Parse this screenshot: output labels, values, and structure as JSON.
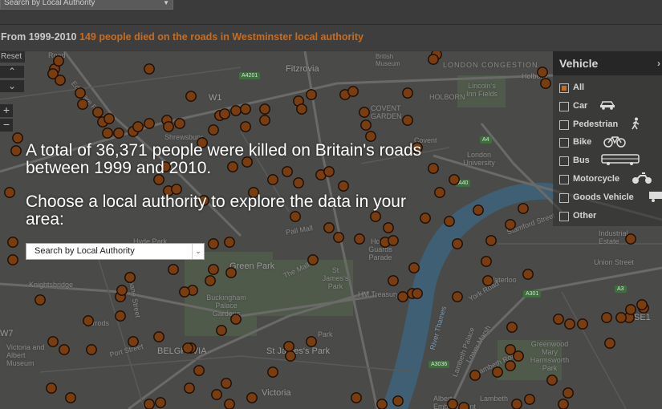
{
  "top_select": {
    "label": "Search by Local Authority"
  },
  "status": {
    "lead": "From 1999-2010",
    "highlight": "149 people died on the roads in Westminster local authority"
  },
  "controls": {
    "reset_label": "Reset",
    "zoom_in": "+",
    "zoom_out": "−"
  },
  "overlay": {
    "headline": "A total of 36,371 people were killed on Britain's roads between 1999 and 2010.",
    "subhead": "Choose a local authority to explore the data in your area:",
    "select_label": "Search by Local Authority"
  },
  "legend": {
    "title": "Vehicle",
    "items": [
      {
        "label": "All",
        "checked": true,
        "icon": "none"
      },
      {
        "label": "Car",
        "checked": false,
        "icon": "car-icon"
      },
      {
        "label": "Pedestrian",
        "checked": false,
        "icon": "pedestrian-icon"
      },
      {
        "label": "Bike",
        "checked": false,
        "icon": "bike-icon"
      },
      {
        "label": "Bus",
        "checked": false,
        "icon": "bus-icon"
      },
      {
        "label": "Motorcycle",
        "checked": false,
        "icon": "motorcycle-icon"
      },
      {
        "label": "Goods Vehicle",
        "checked": false,
        "icon": "truck-icon"
      },
      {
        "label": "Other",
        "checked": false,
        "icon": "none"
      }
    ]
  },
  "map_labels": [
    {
      "text": "Fitzrovia",
      "big": true
    },
    {
      "text": "British Museum",
      "big": false
    },
    {
      "text": "LONDON CONGESTION",
      "big": false
    },
    {
      "text": "HOLBORN",
      "big": false
    },
    {
      "text": "Lincoln's Inn Fields",
      "big": false
    },
    {
      "text": "COVENT GARDEN",
      "big": false
    },
    {
      "text": "W1",
      "big": true
    },
    {
      "text": "Shrewsbury",
      "big": false
    },
    {
      "text": "London University",
      "big": false
    },
    {
      "text": "Stamford Street",
      "big": false
    },
    {
      "text": "Green Park",
      "big": true
    },
    {
      "text": "Pall Mall",
      "big": false
    },
    {
      "text": "The Mall",
      "big": false
    },
    {
      "text": "St James's Park",
      "big": false
    },
    {
      "text": "Horse Guards Parade",
      "big": false
    },
    {
      "text": "HM Treasury",
      "big": false
    },
    {
      "text": "Buckingham Palace Gardens",
      "big": false
    },
    {
      "text": "Waterloo",
      "big": false
    },
    {
      "text": "Lower Marsh",
      "big": false
    },
    {
      "text": "Industrial Estate",
      "big": false
    },
    {
      "text": "Union Street",
      "big": false
    },
    {
      "text": "SE1",
      "big": true
    },
    {
      "text": "BELGRAVIA",
      "big": true
    },
    {
      "text": "St James's Park",
      "big": true
    },
    {
      "text": "Victoria",
      "big": true
    },
    {
      "text": "Greenwood Mary Harmsworth Park",
      "big": false
    },
    {
      "text": "Lambeth Road",
      "big": false
    },
    {
      "text": "Albert Embankment",
      "big": false
    },
    {
      "text": "Lambeth",
      "big": false
    },
    {
      "text": "Knightsbridge",
      "big": false
    },
    {
      "text": "Harrods",
      "big": false
    },
    {
      "text": "Victoria and Albert Museum",
      "big": false
    },
    {
      "text": "Sloane Street",
      "big": false
    },
    {
      "text": "Hyde Park",
      "big": false
    },
    {
      "text": "W7",
      "big": true
    },
    {
      "text": "Port Street",
      "big": false
    },
    {
      "text": "River Thames",
      "big": false
    },
    {
      "text": "Edgware Road",
      "big": false
    },
    {
      "text": "Holborn",
      "big": false
    },
    {
      "text": "Covent",
      "big": false
    },
    {
      "text": "Lambeth Palace",
      "big": false
    },
    {
      "text": "Park",
      "big": false
    },
    {
      "text": "York Road",
      "big": false
    },
    {
      "text": "Road",
      "big": false
    }
  ],
  "road_badges": [
    "A4201",
    "A4",
    "A40",
    "A301",
    "A3036",
    "A3"
  ],
  "colors": {
    "accent": "#c96c1f",
    "dot_fill": "#7a3d10",
    "dot_stroke": "#1a0d04"
  }
}
